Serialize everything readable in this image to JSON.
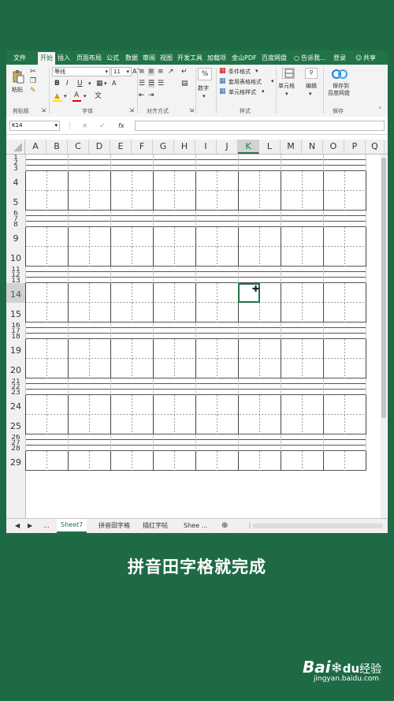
{
  "menu": {
    "tabs": [
      "文件",
      "开始",
      "插入",
      "页面布局",
      "公式",
      "数据",
      "审阅",
      "视图",
      "开发工具",
      "加载项",
      "金山PDF",
      "百度网盘"
    ],
    "active_tab": "开始",
    "tell_me": "告诉我...",
    "login": "登录",
    "share": "共享"
  },
  "ribbon": {
    "paste_label": "粘贴",
    "clipboard_group": "剪贴板",
    "font_name": "等线",
    "font_size": "11",
    "font_group": "字体",
    "bold": "B",
    "italic": "I",
    "underline": "U",
    "font_color_glyph": "A",
    "align_group": "对齐方式",
    "number_label": "数字",
    "number_glyph": "%",
    "conditional_format": "条件格式",
    "table_format": "套用表格格式",
    "cell_styles": "单元格样式",
    "styles_group": "样式",
    "cells_label": "单元格",
    "edit_label": "编辑",
    "save_label_1": "保存到",
    "save_label_2": "百度网盘",
    "save_group": "保存"
  },
  "formula_bar": {
    "name_box": "K14",
    "cancel_glyph": "×",
    "enter_glyph": "✓",
    "fx": "fx",
    "value": ""
  },
  "grid": {
    "columns": [
      "A",
      "B",
      "C",
      "D",
      "E",
      "F",
      "G",
      "H",
      "I",
      "J",
      "K",
      "L",
      "M",
      "N",
      "O",
      "P",
      "Q"
    ],
    "selected_column": "K",
    "rows": [
      "1",
      "2",
      "3",
      "4",
      "5",
      "6",
      "7",
      "8",
      "9",
      "10",
      "11",
      "12",
      "13",
      "14",
      "15",
      "16",
      "17",
      "18",
      "19",
      "20",
      "21",
      "22",
      "23",
      "24",
      "25",
      "26",
      "27",
      "28",
      "29"
    ],
    "selected_row": "14",
    "selected_cell": "K14"
  },
  "sheet_tabs": {
    "tabs": [
      "Sheet7",
      "拼音田字格",
      "描红字帖",
      "Shee ..."
    ],
    "active": "Sheet7",
    "nav_prev": "◀",
    "nav_next": "▶",
    "more": "...",
    "add": "⊕"
  },
  "caption": "拼音田字格就完成",
  "watermark": {
    "brand": "Bai",
    "brand2": "du",
    "product": "经验",
    "url": "jingyan.baidu.com"
  },
  "colors": {
    "accent": "#217346",
    "background": "#1e6a45"
  }
}
